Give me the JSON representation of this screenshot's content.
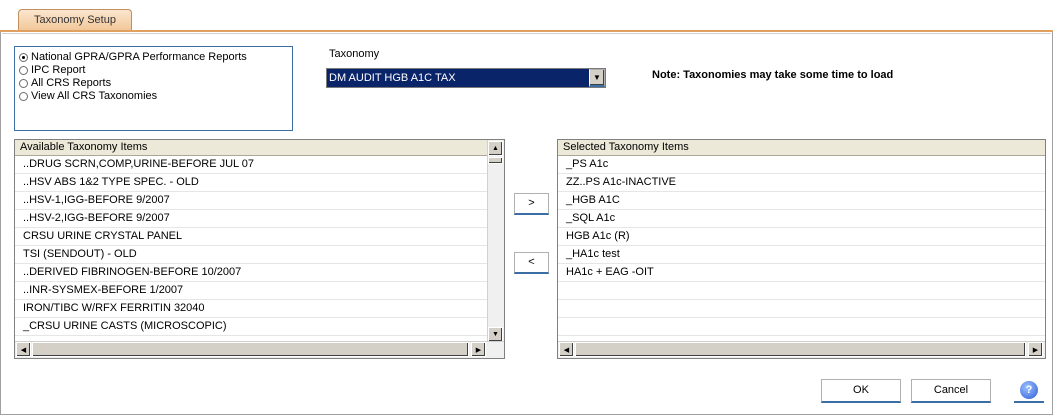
{
  "tab": {
    "label": "Taxonomy Setup"
  },
  "report_options": [
    {
      "label": "National GPRA/GPRA Performance Reports",
      "selected": true
    },
    {
      "label": "IPC Report",
      "selected": false
    },
    {
      "label": "All CRS Reports",
      "selected": false
    },
    {
      "label": "View All CRS Taxonomies",
      "selected": false
    }
  ],
  "taxonomy": {
    "label": "Taxonomy",
    "value": "DM AUDIT HGB A1C TAX"
  },
  "note": "Note:  Taxonomies may take some time to load",
  "available": {
    "header": "Available Taxonomy Items",
    "items": [
      "..DRUG SCRN,COMP,URINE-BEFORE JUL 07",
      "..HSV ABS 1&2 TYPE SPEC. - OLD",
      "..HSV-1,IGG-BEFORE 9/2007",
      "..HSV-2,IGG-BEFORE 9/2007",
      "CRSU URINE CRYSTAL PANEL",
      "TSI (SENDOUT) - OLD",
      "..DERIVED FIBRINOGEN-BEFORE 10/2007",
      "..INR-SYSMEX-BEFORE 1/2007",
      "IRON/TIBC W/RFX FERRITIN 32040",
      "_CRSU URINE CASTS (MICROSCOPIC)"
    ]
  },
  "selected": {
    "header": "Selected Taxonomy Items",
    "items": [
      "_PS A1c",
      "ZZ..PS A1c-INACTIVE",
      "_HGB A1C",
      "_SQL A1c",
      "HGB A1c (R)",
      "_HA1c test",
      "HA1c + EAG -OIT",
      "",
      "",
      ""
    ]
  },
  "buttons": {
    "add": ">",
    "remove": "<",
    "ok": "OK",
    "cancel": "Cancel",
    "help": "?"
  },
  "icons": {
    "dropdown": "▼",
    "up": "▲",
    "down": "▼",
    "left": "◀",
    "right": "▶"
  }
}
